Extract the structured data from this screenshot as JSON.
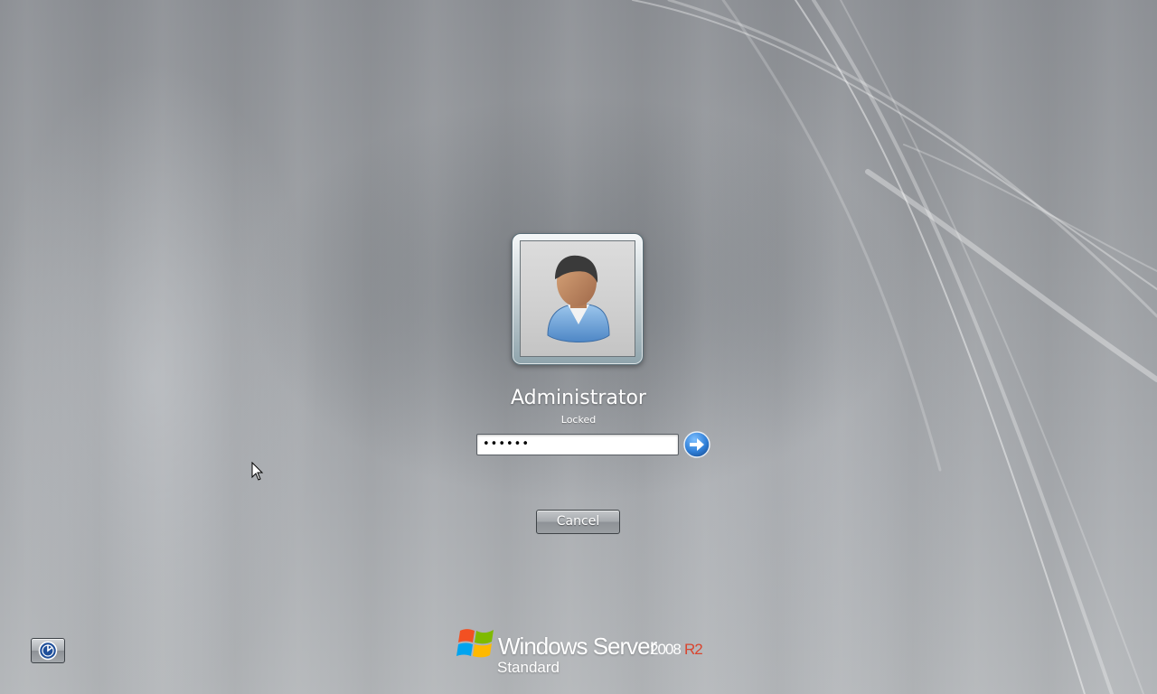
{
  "user": {
    "name": "Administrator",
    "status": "Locked",
    "avatar_icon": "user-avatar-icon"
  },
  "password": {
    "value": "••••••"
  },
  "buttons": {
    "submit_icon": "arrow-right-icon",
    "cancel_label": "Cancel",
    "ease_of_access_icon": "ease-of-access-icon"
  },
  "branding": {
    "product": "Windows Server",
    "version": "2008",
    "release": "R2",
    "edition": "Standard",
    "logo_icon": "windows-flag-icon"
  },
  "colors": {
    "background": "#9a9da1",
    "submit_blue": "#2f7fd8",
    "r2_red": "#d9452f"
  }
}
